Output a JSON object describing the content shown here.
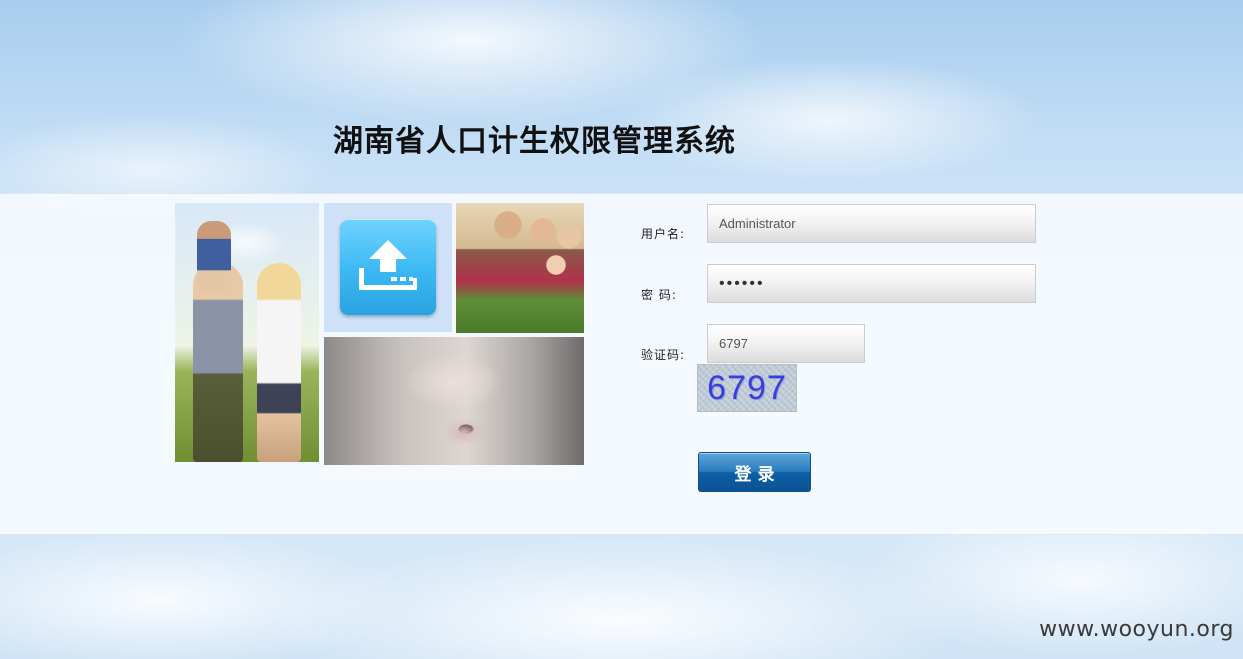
{
  "header": {
    "title": "湖南省人口计生权限管理系统"
  },
  "photos": {
    "family": "family-photo",
    "upload": "upload-icon",
    "elders": "elders-photo",
    "baby": "baby-photo"
  },
  "form": {
    "username_label": "用户名:",
    "username_value": "Administrator",
    "password_label": "密  码:",
    "password_value": "••••••",
    "captcha_label": "验证码:",
    "captcha_value": "6797",
    "captcha_image_text": "6797",
    "submit_label": "登录"
  },
  "footer": {
    "watermark": "www.wooyun.org"
  },
  "colors": {
    "button": "#0d5fa5",
    "captcha_text": "#3a3ee0",
    "icon_tile": "#3bb8f3"
  }
}
